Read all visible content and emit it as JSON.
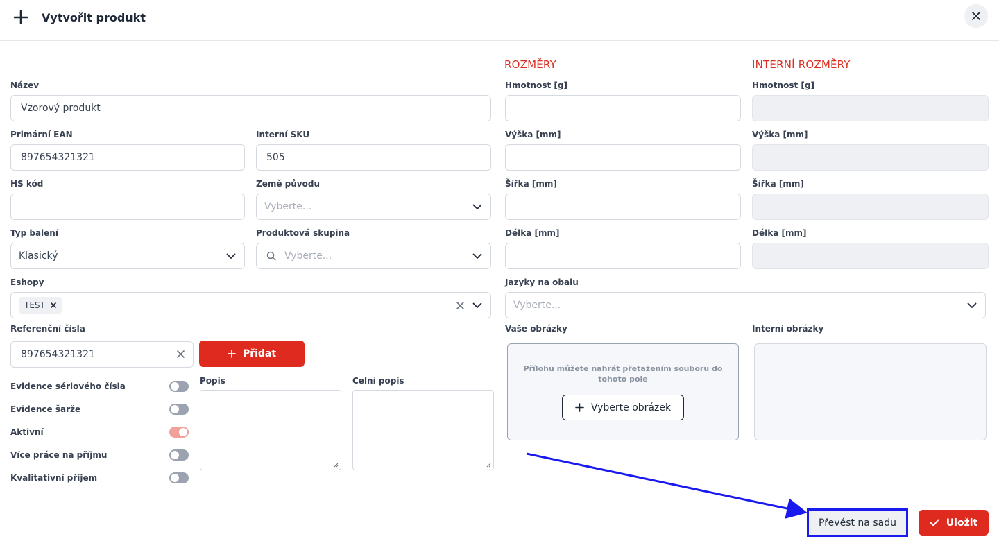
{
  "header": {
    "title": "Vytvořit produkt"
  },
  "sections": {
    "dimensions": "ROZMĚRY",
    "internal_dimensions": "INTERNÍ ROZMĚRY"
  },
  "fields": {
    "name": {
      "label": "Název",
      "value": "Vzorový produkt"
    },
    "primary_ean": {
      "label": "Primární EAN",
      "value": "897654321321"
    },
    "internal_sku": {
      "label": "Interní SKU",
      "value": "505"
    },
    "hs_code": {
      "label": "HS kód",
      "value": ""
    },
    "country_of_origin": {
      "label": "Země původu",
      "placeholder": "Vyberte..."
    },
    "package_type": {
      "label": "Typ balení",
      "value": "Klasický"
    },
    "product_group": {
      "label": "Produktová skupina",
      "placeholder": "Vyberte..."
    },
    "eshops": {
      "label": "Eshopy",
      "tags": [
        "TEST"
      ]
    },
    "reference_numbers": {
      "label": "Referenční čísla",
      "value": "897654321321",
      "add_label": "Přidat"
    },
    "description": {
      "label": "Popis"
    },
    "customs_description": {
      "label": "Celní popis"
    },
    "packaging_languages": {
      "label": "Jazyky na obalu",
      "placeholder": "Vyberte..."
    }
  },
  "dimensions": [
    {
      "label": "Hmotnost [g]"
    },
    {
      "label": "Výška [mm]"
    },
    {
      "label": "Šířka [mm]"
    },
    {
      "label": "Délka [mm]"
    }
  ],
  "internal_dimensions": [
    {
      "label": "Hmotnost [g]"
    },
    {
      "label": "Výška [mm]"
    },
    {
      "label": "Šířka [mm]"
    },
    {
      "label": "Délka [mm]"
    }
  ],
  "toggles": [
    {
      "label": "Evidence sériového čísla",
      "on": false
    },
    {
      "label": "Evidence šarže",
      "on": false
    },
    {
      "label": "Aktivní",
      "on": true
    },
    {
      "label": "Více práce na příjmu",
      "on": false
    },
    {
      "label": "Kvalitativní příjem",
      "on": false
    }
  ],
  "images": {
    "your_label": "Vaše obrázky",
    "internal_label": "Interní obrázky",
    "drop_hint": "Přílohu můžete nahrát přetažením souboru do tohoto pole",
    "pick_label": "Vyberte obrázek"
  },
  "actions": {
    "convert_label": "Převést na sadu",
    "save_label": "Uložit"
  },
  "colors": {
    "accent": "#df2b1f",
    "section_title": "#dc2f23",
    "highlight": "#1a1af0"
  }
}
